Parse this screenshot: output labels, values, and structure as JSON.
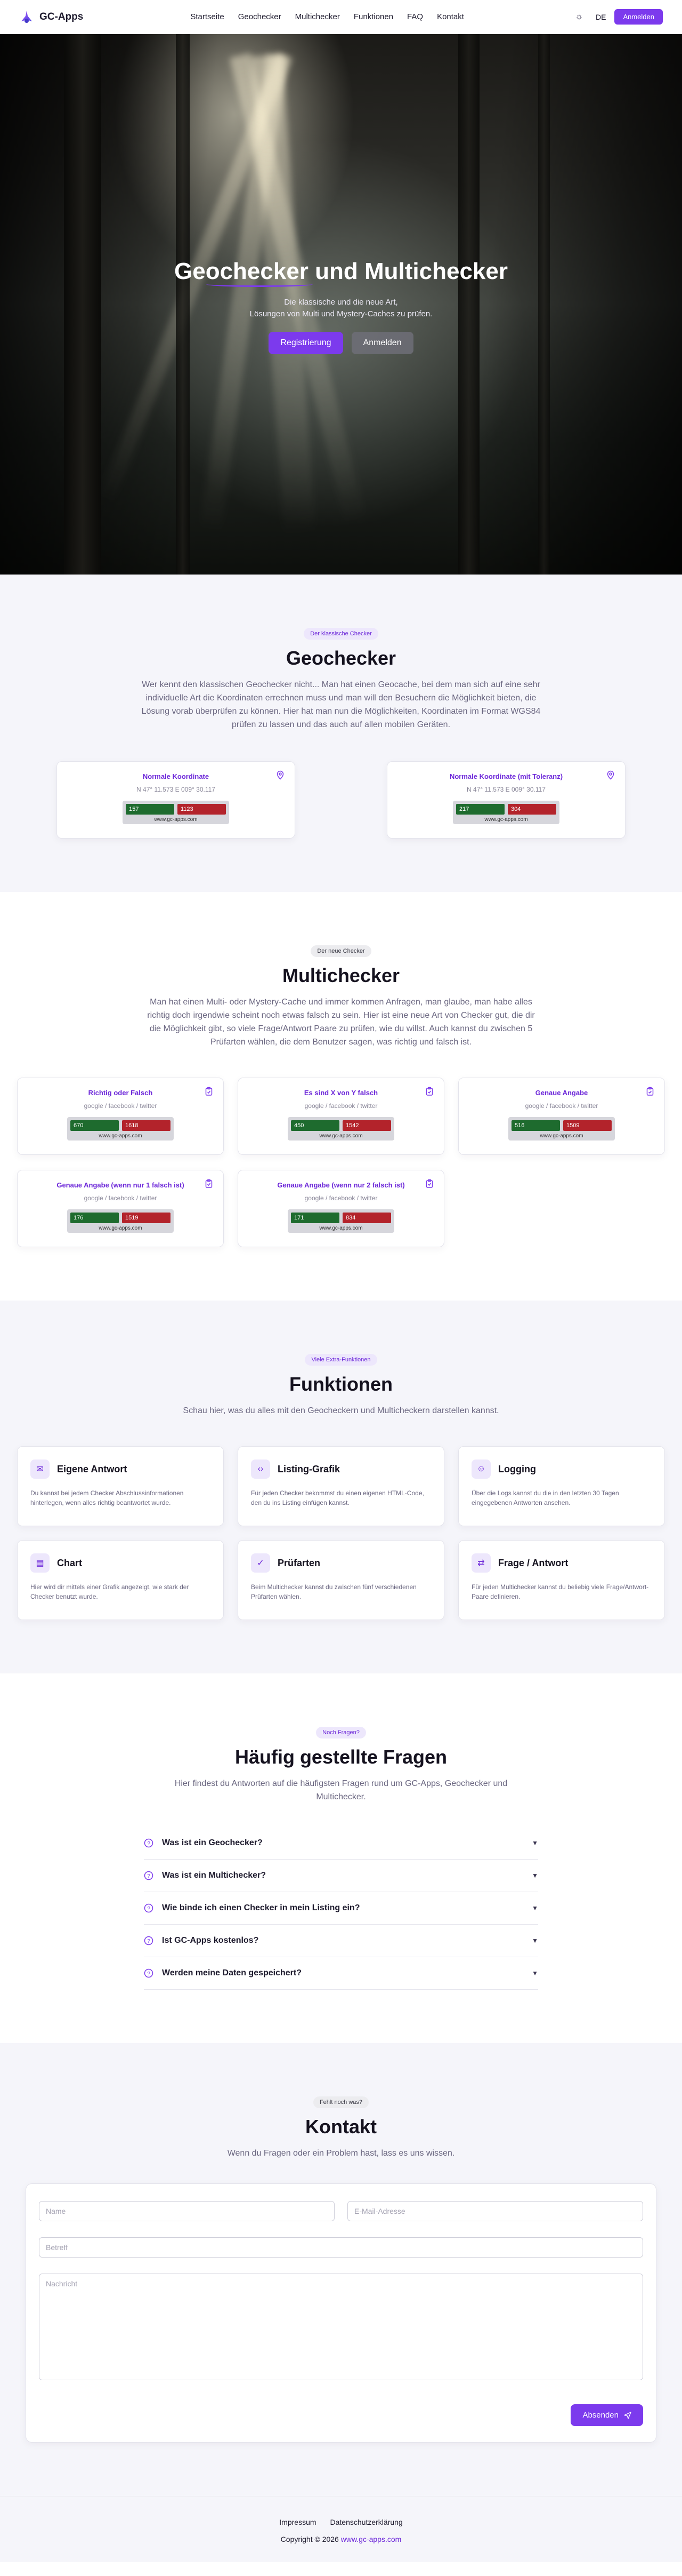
{
  "nav": {
    "brand": "GC-Apps",
    "links": [
      "Startseite",
      "Geochecker",
      "Multichecker",
      "Funktionen",
      "FAQ",
      "Kontakt"
    ],
    "lang": "DE",
    "login": "Anmelden"
  },
  "hero": {
    "title": "Geochecker und Multichecker",
    "sub1": "Die klassische und die neue Art,",
    "sub2": "Lösungen von Multi und Mystery-Caches zu prüfen.",
    "register": "Registrierung",
    "login": "Anmelden"
  },
  "geo": {
    "pill": "Der klassische Checker",
    "title": "Geochecker",
    "text": "Wer kennt den klassischen Geochecker nicht... Man hat einen Geocache, bei dem man sich auf eine sehr individuelle Art die Koordinaten errechnen muss und man will den Besuchern die Möglichkeit bieten, die Lösung vorab überprüfen zu können. Hier hat man nun die Möglichkeiten, Koordinaten im Format WGS84 prüfen zu lassen und das auch auf allen mobilen Geräten.",
    "cards": [
      {
        "title": "Normale Koordinate",
        "sub": "N 47° 11.573 E 009° 30.117",
        "green": "157",
        "red": "1123",
        "url": "www.gc-apps.com"
      },
      {
        "title": "Normale Koordinate (mit Toleranz)",
        "sub": "N 47° 11.573 E 009° 30.117",
        "green": "217",
        "red": "304",
        "url": "www.gc-apps.com"
      }
    ]
  },
  "multi": {
    "pill": "Der neue Checker",
    "title": "Multichecker",
    "text": "Man hat einen Multi- oder Mystery-Cache und immer kommen Anfragen, man glaube, man habe alles richtig doch irgendwie scheint noch etwas falsch zu sein. Hier ist eine neue Art von Checker gut, die dir die Möglichkeit gibt, so viele Frage/Antwort Paare zu prüfen, wie du willst. Auch kannst du zwischen 5 Prüfarten wählen, die dem Benutzer sagen, was richtig und falsch ist.",
    "cards": [
      {
        "title": "Richtig oder Falsch",
        "sub": "google / facebook / twitter",
        "green": "670",
        "red": "1618",
        "url": "www.gc-apps.com"
      },
      {
        "title": "Es sind X von Y falsch",
        "sub": "google / facebook / twitter",
        "green": "450",
        "red": "1542",
        "url": "www.gc-apps.com"
      },
      {
        "title": "Genaue Angabe",
        "sub": "google / facebook / twitter",
        "green": "516",
        "red": "1509",
        "url": "www.gc-apps.com"
      },
      {
        "title": "Genaue Angabe (wenn nur 1 falsch ist)",
        "sub": "google / facebook / twitter",
        "green": "176",
        "red": "1519",
        "url": "www.gc-apps.com"
      },
      {
        "title": "Genaue Angabe (wenn nur 2 falsch ist)",
        "sub": "google / facebook / twitter",
        "green": "171",
        "red": "834",
        "url": "www.gc-apps.com"
      }
    ]
  },
  "features": {
    "pill": "Viele Extra-Funktionen",
    "title": "Funktionen",
    "text": "Schau hier, was du alles mit den Geocheckern und Multicheckern darstellen kannst.",
    "items": [
      {
        "icon": "chat-icon",
        "glyph": "✉",
        "title": "Eigene Antwort",
        "text": "Du kannst bei jedem Checker Abschlussinformationen hinterlegen, wenn alles richtig beantwortet wurde."
      },
      {
        "icon": "code-icon",
        "glyph": "‹›",
        "title": "Listing-Grafik",
        "text": "Für jeden Checker bekommst du einen eigenen HTML-Code, den du ins Listing einfügen kannst."
      },
      {
        "icon": "log-icon",
        "glyph": "☺",
        "title": "Logging",
        "text": "Über die Logs kannst du die in den letzten 30 Tagen eingegebenen Antworten ansehen."
      },
      {
        "icon": "chart-icon",
        "glyph": "▤",
        "title": "Chart",
        "text": "Hier wird dir mittels einer Grafik angezeigt, wie stark der Checker benutzt wurde."
      },
      {
        "icon": "check-icon",
        "glyph": "✓",
        "title": "Prüfarten",
        "text": "Beim Multichecker kannst du zwischen fünf verschiedenen Prüfarten wählen."
      },
      {
        "icon": "qa-icon",
        "glyph": "⇄",
        "title": "Frage / Antwort",
        "text": "Für jeden Multichecker kannst du beliebig viele Frage/Antwort-Paare definieren."
      }
    ]
  },
  "faq": {
    "pill": "Noch Fragen?",
    "title": "Häufig gestellte Fragen",
    "text": "Hier findest du Antworten auf die häufigsten Fragen rund um GC-Apps, Geochecker und Multichecker.",
    "items": [
      "Was ist ein Geochecker?",
      "Was ist ein Multichecker?",
      "Wie binde ich einen Checker in mein Listing ein?",
      "Ist GC-Apps kostenlos?",
      "Werden meine Daten gespeichert?"
    ]
  },
  "contact": {
    "pill": "Fehlt noch was?",
    "title": "Kontakt",
    "text": "Wenn du Fragen oder ein Problem hast, lass es uns wissen.",
    "name_ph": "Name",
    "email_ph": "E-Mail-Adresse",
    "subject_ph": "Betreff",
    "message_ph": "Nachricht",
    "send": "Absenden"
  },
  "footer": {
    "impressum": "Impressum",
    "privacy": "Datenschutzerklärung",
    "copy": "Copyright © 2026",
    "site": "www.gc-apps.com"
  },
  "colors": {
    "accent": "#7c3aed",
    "success": "#1e6b2e",
    "error": "#b3232b"
  }
}
